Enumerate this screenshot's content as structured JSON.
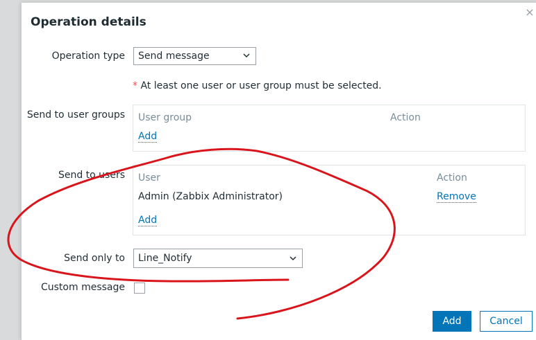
{
  "dialog": {
    "title": "Operation details",
    "close_symbol": "×"
  },
  "form": {
    "operation_type": {
      "label": "Operation type",
      "value": "Send message"
    },
    "hint": {
      "asterisk": "*",
      "text": " At least one user or user group must be selected."
    },
    "user_groups": {
      "label": "Send to user groups",
      "columns": [
        "User group",
        "Action"
      ],
      "add_label": "Add"
    },
    "users": {
      "label": "Send to users",
      "columns": [
        "User",
        "Action"
      ],
      "rows": [
        {
          "name": "Admin (Zabbix Administrator)",
          "action": "Remove"
        }
      ],
      "add_label": "Add"
    },
    "send_only_to": {
      "label": "Send only to",
      "value": "Line_Notify"
    },
    "custom_message": {
      "label": "Custom message",
      "checked": false
    }
  },
  "footer": {
    "add_label": "Add",
    "cancel_label": "Cancel"
  },
  "colors": {
    "primary": "#0275b8",
    "annotation": "#d9141b",
    "required": "#e45959"
  },
  "icons": {
    "close": "close-icon",
    "dropdown": "chevron-down-icon"
  }
}
